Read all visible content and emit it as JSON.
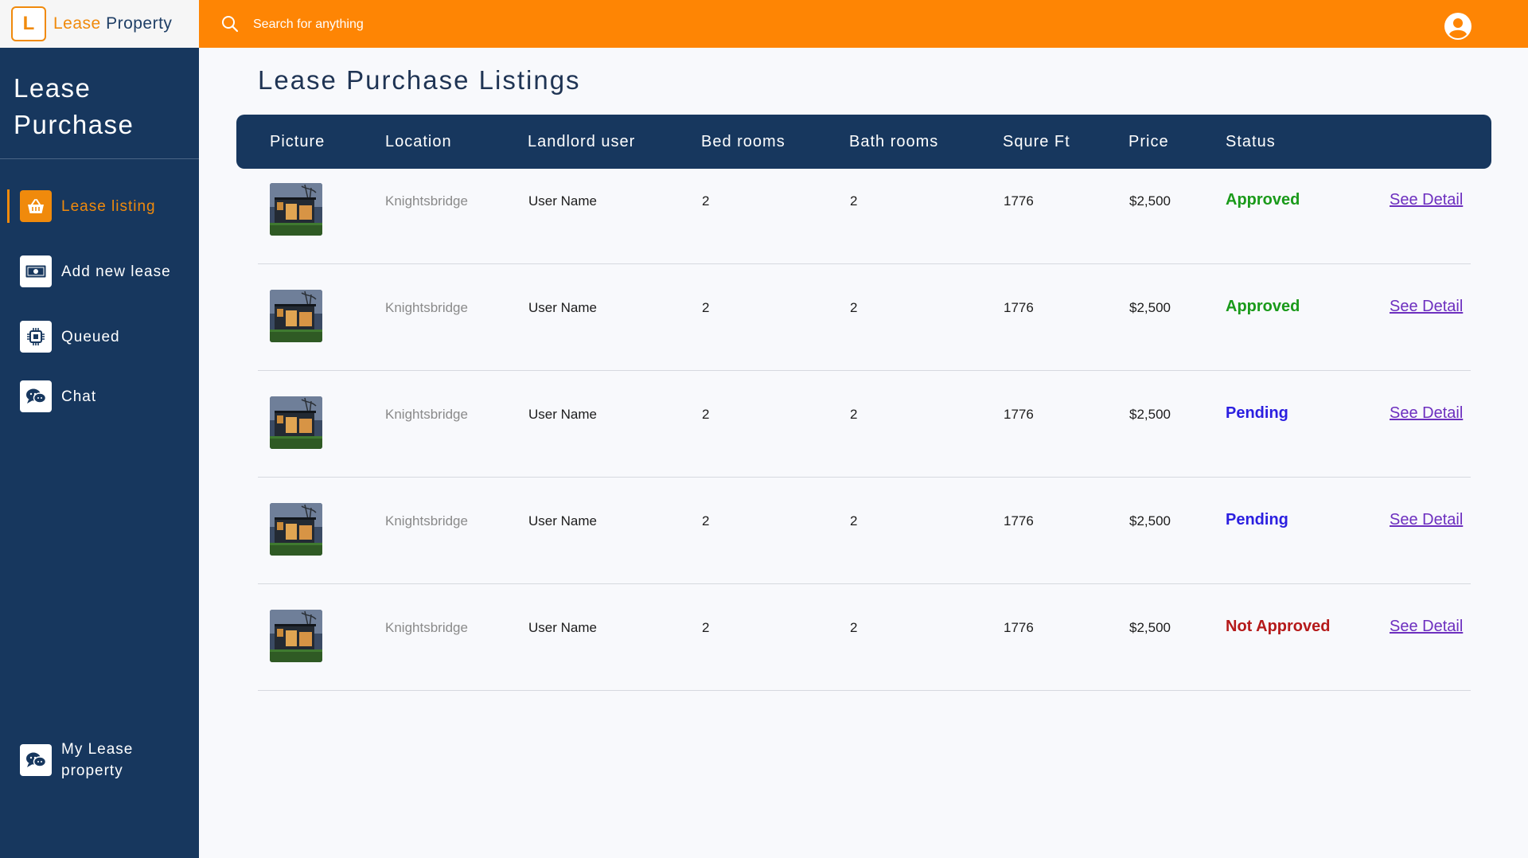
{
  "brand": {
    "logo_letter": "L",
    "name_part1": "Lease",
    "name_part2": "Property"
  },
  "colors": {
    "accent": "#fe8504",
    "sidebar": "#17375e",
    "approved": "#1a9a1a",
    "pending": "#2b1fe0",
    "not_approved": "#b51a1a",
    "link": "#6d2fbf"
  },
  "sidebar": {
    "title": "Lease Purchase",
    "items": [
      {
        "label": "Lease listing",
        "icon": "basket-icon",
        "active": true
      },
      {
        "label": "Add new lease",
        "icon": "banknote-icon",
        "active": false
      },
      {
        "label": "Queued",
        "icon": "chip-icon",
        "active": false
      },
      {
        "label": "Chat",
        "icon": "chat-icon",
        "active": false
      }
    ],
    "footer_item": {
      "label": "My Lease property",
      "icon": "chat-icon"
    }
  },
  "topbar": {
    "search_placeholder": "Search for anything",
    "search_value": ""
  },
  "page": {
    "title": "Lease Purchase Listings"
  },
  "table": {
    "headers": [
      "Picture",
      "Location",
      "Landlord user",
      "Bed rooms",
      "Bath rooms",
      "Squre Ft",
      "Price",
      "Status"
    ],
    "rows": [
      {
        "location": "Knightsbridge",
        "landlord": "User Name",
        "bedrooms": "2",
        "bathrooms": "2",
        "sqft": "1776",
        "price": "$2,500",
        "status": "Approved",
        "link": "See Detail"
      },
      {
        "location": "Knightsbridge",
        "landlord": "User Name",
        "bedrooms": "2",
        "bathrooms": "2",
        "sqft": "1776",
        "price": "$2,500",
        "status": "Approved",
        "link": "See Detail"
      },
      {
        "location": "Knightsbridge",
        "landlord": "User Name",
        "bedrooms": "2",
        "bathrooms": "2",
        "sqft": "1776",
        "price": "$2,500",
        "status": "Pending",
        "link": "See Detail"
      },
      {
        "location": "Knightsbridge",
        "landlord": "User Name",
        "bedrooms": "2",
        "bathrooms": "2",
        "sqft": "1776",
        "price": "$2,500",
        "status": "Pending",
        "link": "See Detail"
      },
      {
        "location": "Knightsbridge",
        "landlord": "User Name",
        "bedrooms": "2",
        "bathrooms": "2",
        "sqft": "1776",
        "price": "$2,500",
        "status": "Not Approved",
        "link": "See Detail"
      }
    ]
  }
}
